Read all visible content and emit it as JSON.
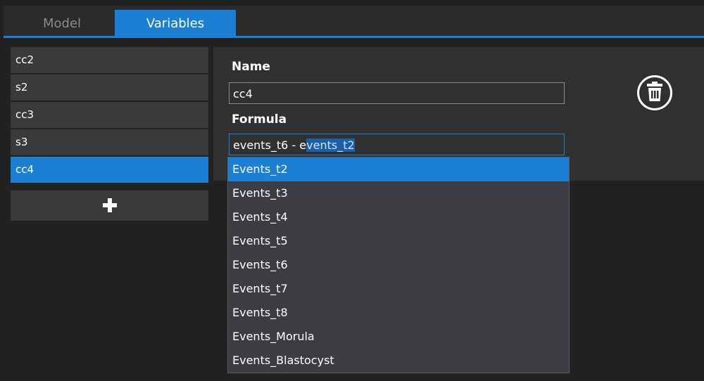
{
  "tabs": [
    {
      "label": "Model",
      "active": false
    },
    {
      "label": "Variables",
      "active": true
    }
  ],
  "variables": [
    {
      "label": "cc2"
    },
    {
      "label": "s2"
    },
    {
      "label": "cc3"
    },
    {
      "label": "s3"
    },
    {
      "label": "cc4",
      "selected": true
    }
  ],
  "add_button": {
    "icon": "plus-icon"
  },
  "editor": {
    "name_label": "Name",
    "name_value": "cc4",
    "formula_label": "Formula",
    "formula_typed": "events_t6 - e",
    "formula_autocomplete": "vents_t2",
    "delete_icon": "trash-icon"
  },
  "autocomplete": {
    "options": [
      "Events_t2",
      "Events_t3",
      "Events_t4",
      "Events_t5",
      "Events_t6",
      "Events_t7",
      "Events_t8",
      "Events_Morula",
      "Events_Blastocyst"
    ],
    "highlighted": "Events_t2"
  },
  "colors": {
    "accent": "#1b7fd3",
    "background": "#212121",
    "panel": "#303030",
    "list_item": "#3a3a3a"
  }
}
